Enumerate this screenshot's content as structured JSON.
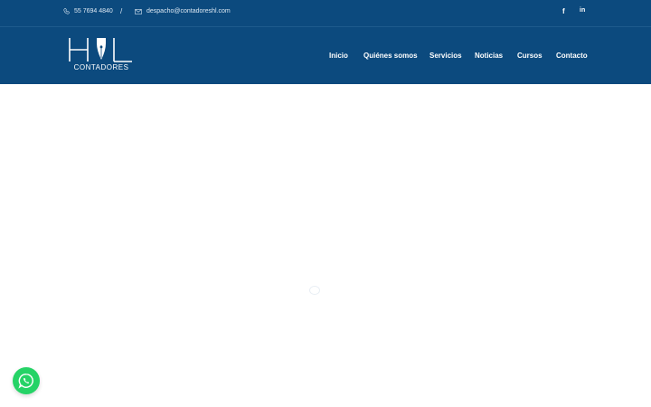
{
  "topbar": {
    "phone": "55 7694 4840",
    "separator": "/",
    "email": "despacho@contadoreshl.com",
    "social": {
      "facebook": "f",
      "linkedin": "in"
    }
  },
  "brand": {
    "logo_text": "CONTADORES"
  },
  "nav": {
    "items": [
      "Inicio",
      "Quiénes somos",
      "Servicios",
      "Noticias",
      "Cursos",
      "Contacto"
    ]
  },
  "icons": {
    "phone": "phone-icon",
    "email": "envelope-icon",
    "facebook": "facebook-icon",
    "linkedin": "linkedin-icon",
    "whatsapp": "whatsapp-icon",
    "loader": "loader-icon"
  },
  "colors": {
    "header": "#0c4a7e",
    "whatsapp": "#25d366",
    "background": "#ffffff"
  }
}
